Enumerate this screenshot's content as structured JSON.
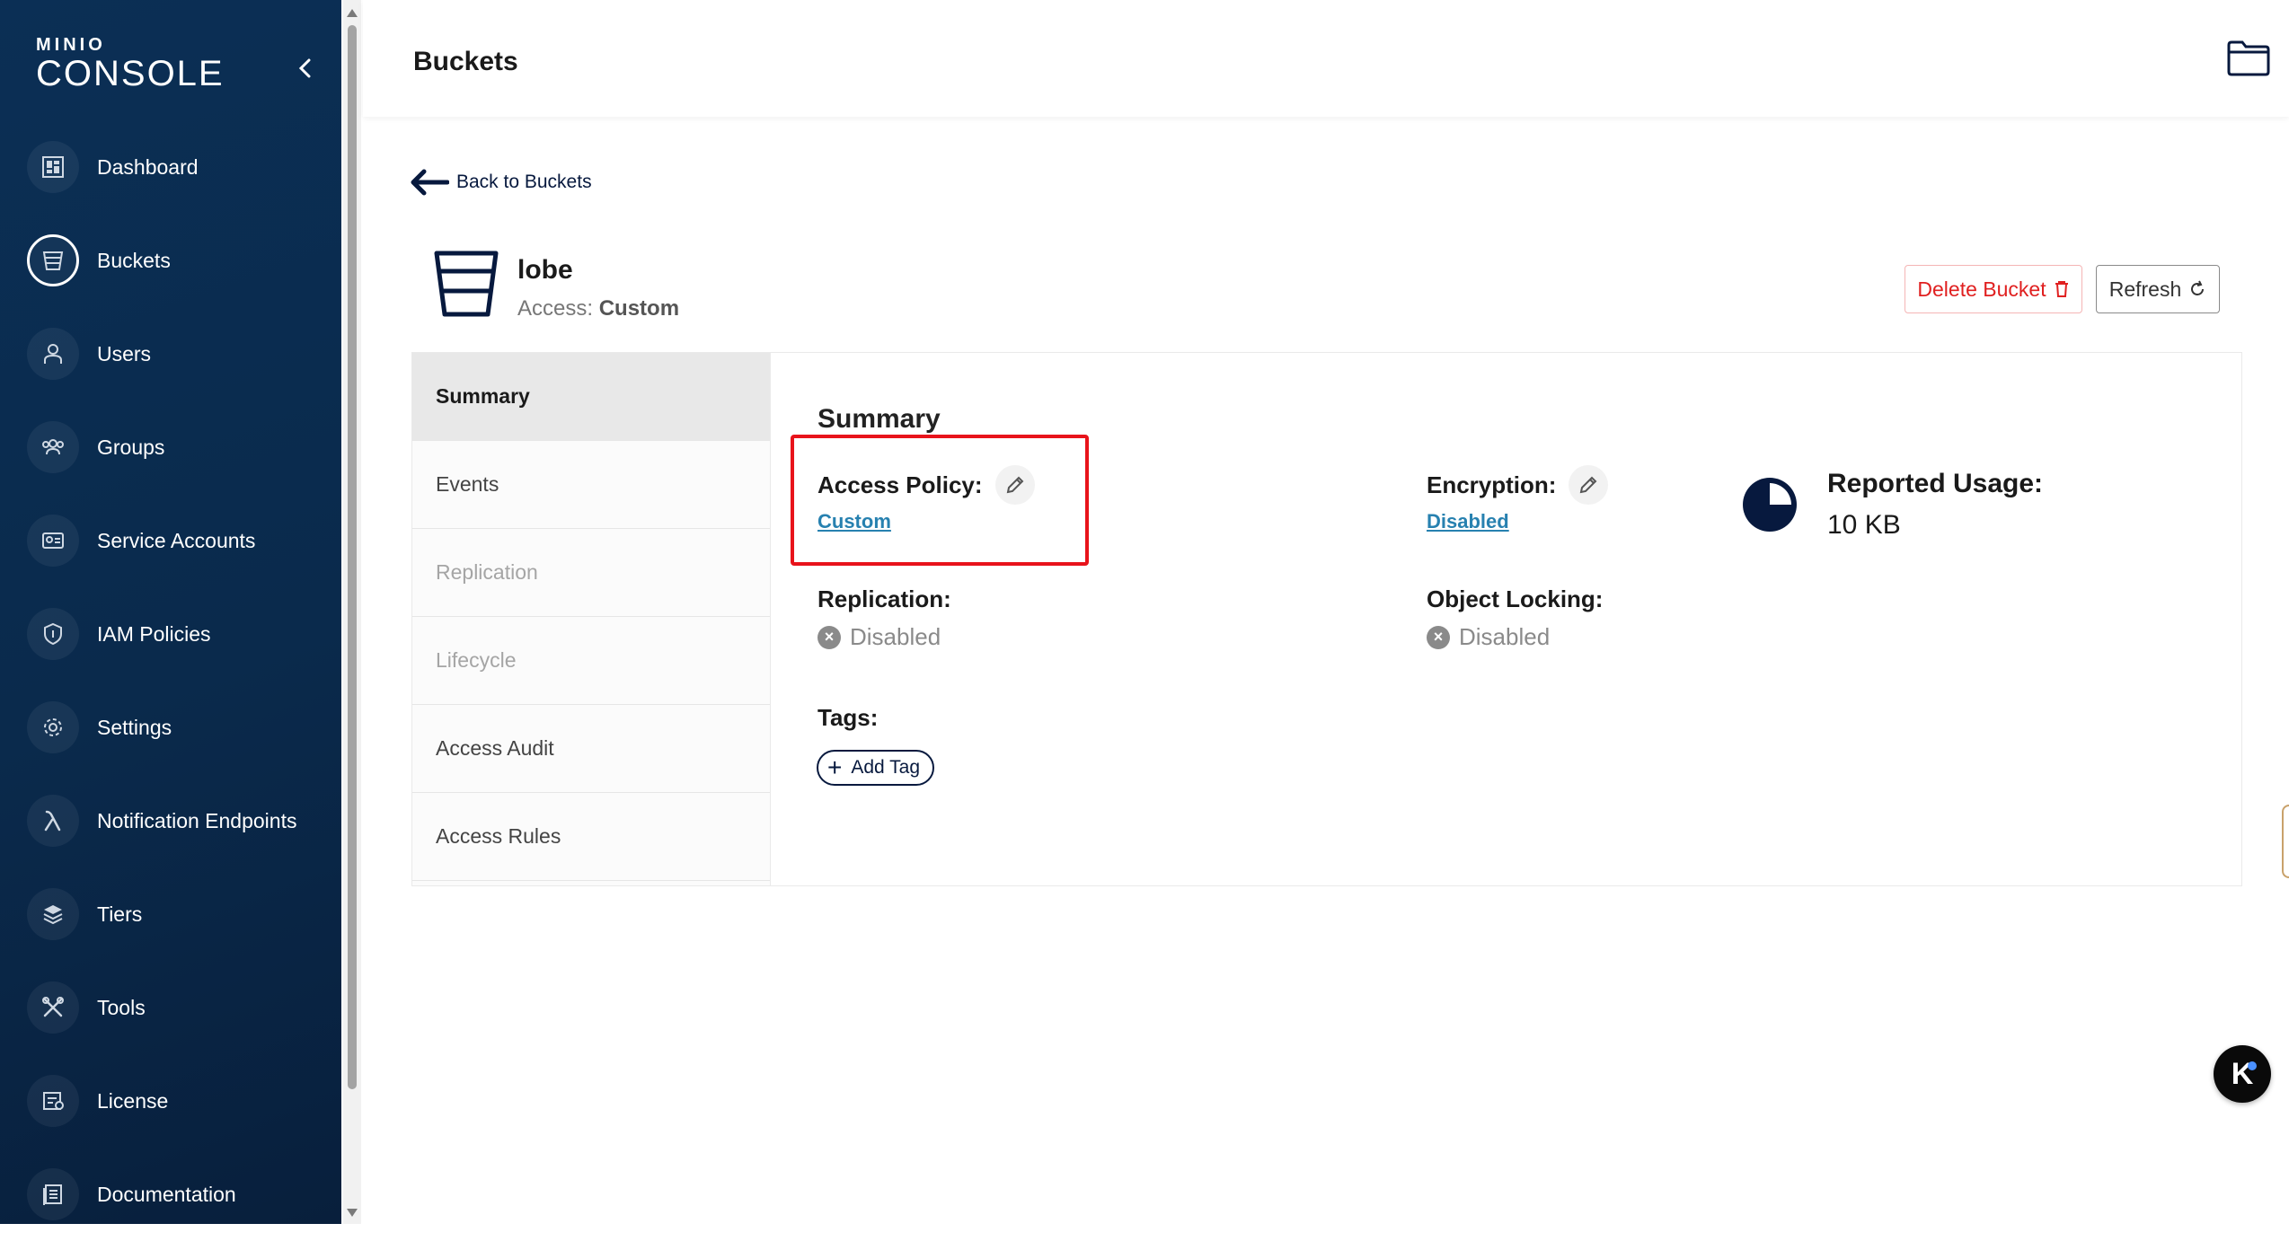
{
  "sidebar": {
    "logo_top": "MINIO",
    "logo_bottom": "CONSOLE",
    "items": [
      {
        "label": "Dashboard",
        "icon": "dashboard-icon",
        "active": false
      },
      {
        "label": "Buckets",
        "icon": "bucket-icon",
        "active": true
      },
      {
        "label": "Users",
        "icon": "user-icon",
        "active": false
      },
      {
        "label": "Groups",
        "icon": "groups-icon",
        "active": false
      },
      {
        "label": "Service Accounts",
        "icon": "service-accounts-icon",
        "active": false
      },
      {
        "label": "IAM Policies",
        "icon": "shield-icon",
        "active": false
      },
      {
        "label": "Settings",
        "icon": "gear-icon",
        "active": false
      },
      {
        "label": "Notification Endpoints",
        "icon": "lambda-icon",
        "active": false
      },
      {
        "label": "Tiers",
        "icon": "layers-icon",
        "active": false
      },
      {
        "label": "Tools",
        "icon": "tools-icon",
        "active": false
      },
      {
        "label": "License",
        "icon": "license-icon",
        "active": false
      },
      {
        "label": "Documentation",
        "icon": "documentation-icon",
        "active": false
      }
    ]
  },
  "header": {
    "title": "Buckets"
  },
  "back_link": "Back to Buckets",
  "bucket": {
    "name": "lobe",
    "access_prefix": "Access: ",
    "access_value": "Custom"
  },
  "actions": {
    "delete_label": "Delete Bucket",
    "refresh_label": "Refresh"
  },
  "tabs": [
    {
      "label": "Summary",
      "state": "active"
    },
    {
      "label": "Events",
      "state": "normal"
    },
    {
      "label": "Replication",
      "state": "disabled"
    },
    {
      "label": "Lifecycle",
      "state": "disabled"
    },
    {
      "label": "Access Audit",
      "state": "normal"
    },
    {
      "label": "Access Rules",
      "state": "normal"
    }
  ],
  "summary": {
    "title": "Summary",
    "access_policy_label": "Access Policy:",
    "access_policy_value": "Custom",
    "encryption_label": "Encryption:",
    "encryption_value": "Disabled",
    "replication_label": "Replication:",
    "replication_value": "Disabled",
    "object_locking_label": "Object Locking:",
    "object_locking_value": "Disabled",
    "reported_usage_label": "Reported Usage:",
    "reported_usage_value": "10 KB",
    "tags_label": "Tags:",
    "add_tag_label": "Add Tag"
  },
  "colors": {
    "sidebar_bg": "#0a2a4c",
    "accent_link": "#2781b0",
    "danger": "#e02020",
    "highlight": "#e8131b"
  }
}
